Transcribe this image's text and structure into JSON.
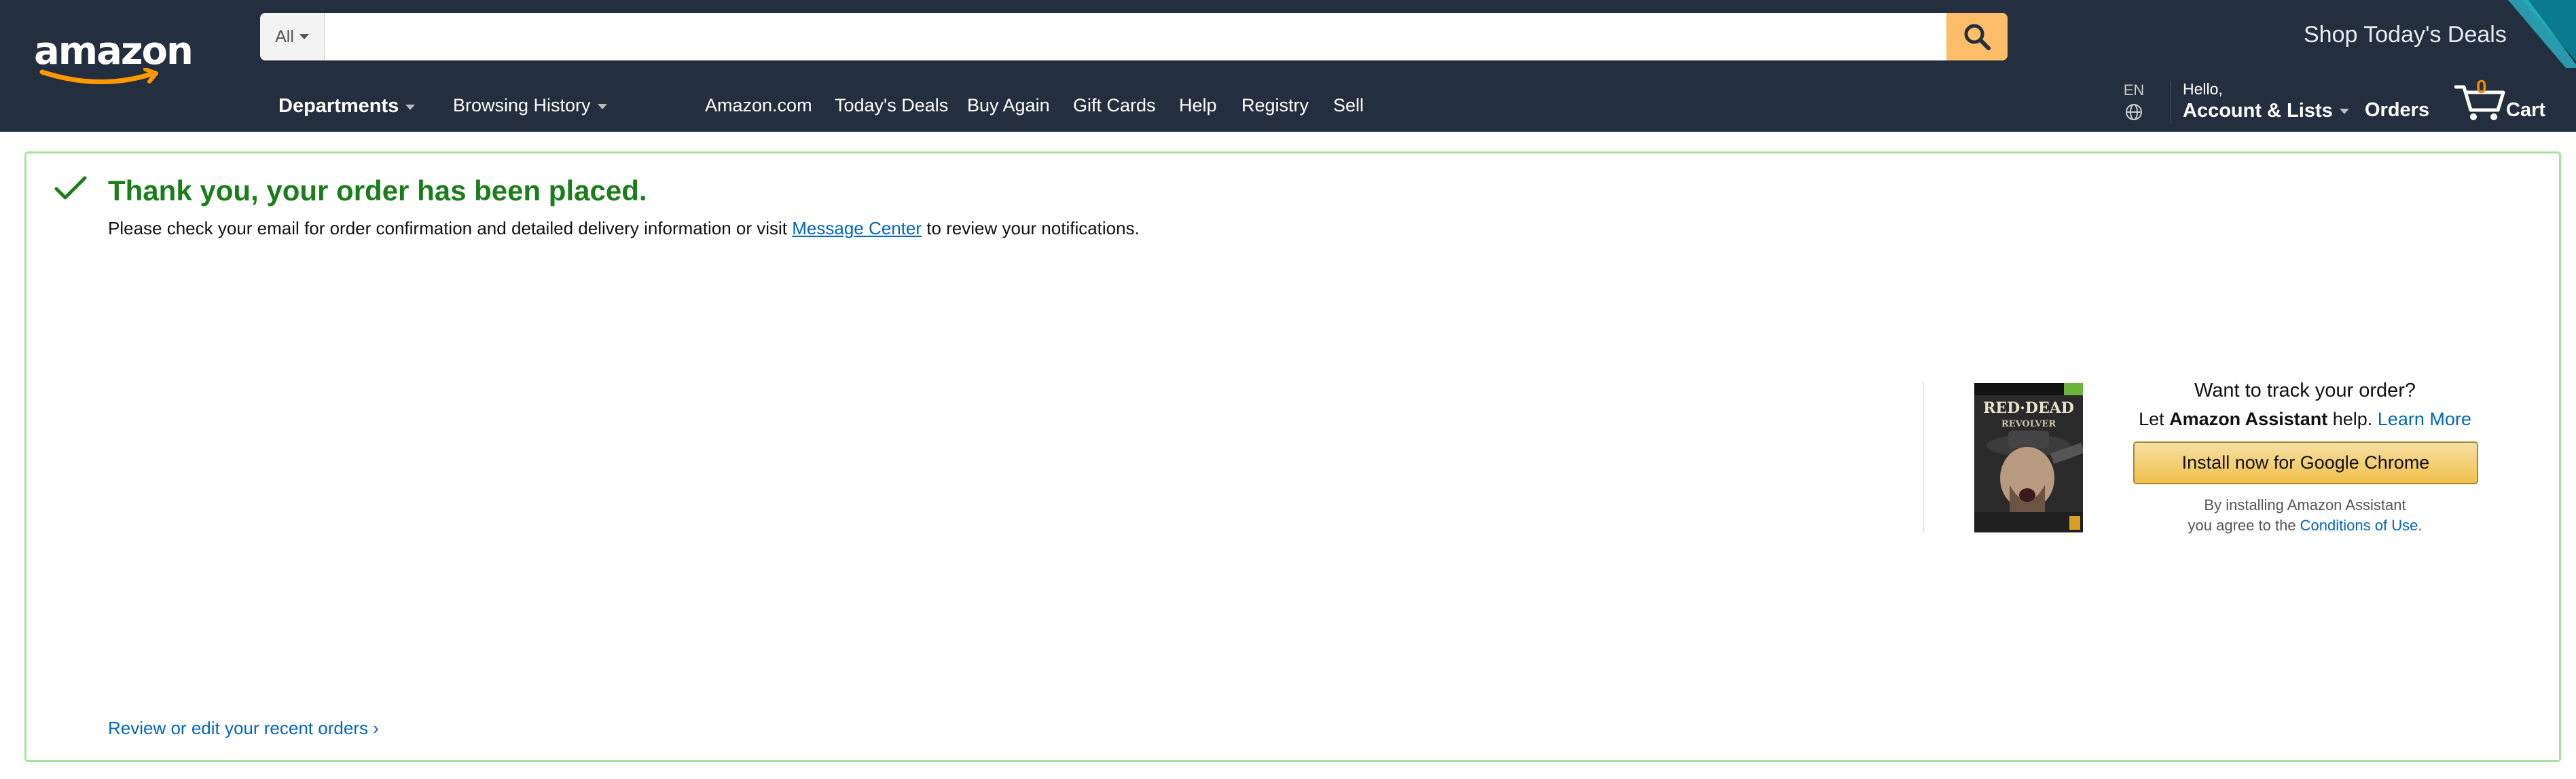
{
  "header": {
    "logo_text": "amazon",
    "search": {
      "scope": "All",
      "value": "",
      "placeholder": ""
    },
    "deals_banner": "Shop Today's Deals",
    "nav_primary": [
      {
        "label": "Departments"
      },
      {
        "label": "Browsing History"
      }
    ],
    "nav_links": [
      "Amazon.com",
      "Today's Deals",
      "Buy Again",
      "Gift Cards",
      "Help",
      "Registry",
      "Sell"
    ],
    "language": "EN",
    "account": {
      "hello": "Hello,",
      "label": "Account & Lists"
    },
    "orders": "Orders",
    "cart": {
      "count": "0",
      "label": "Cart"
    }
  },
  "confirmation": {
    "title": "Thank you, your order has been placed.",
    "message_before": "Please check your email for order confirmation and detailed delivery information or visit ",
    "message_link": "Message Center",
    "message_after": " to review your notifications.",
    "review_link": "Review or edit your recent orders ›"
  },
  "promo": {
    "product_image_alt": "Red Dead Revolver game cover",
    "product_cover_text": "RED DEAD REVOLVER",
    "question": "Want to track your order?",
    "sub_before": "Let ",
    "sub_bold": "Amazon Assistant",
    "sub_after": " help. ",
    "learn_more": "Learn More",
    "install_label": "Install now for Google Chrome",
    "fine_line1": "By installing Amazon Assistant",
    "fine_line2_before": "you agree to the ",
    "fine_link": "Conditions of Use",
    "fine_line2_after": "."
  },
  "colors": {
    "header_bg": "#232f3e",
    "search_button": "#febd69",
    "success_green": "#1a7d1a",
    "box_border": "#a4e59a",
    "link_blue": "#0066c0",
    "cart_count": "#f08804",
    "button_gold": "#f0c14b"
  }
}
